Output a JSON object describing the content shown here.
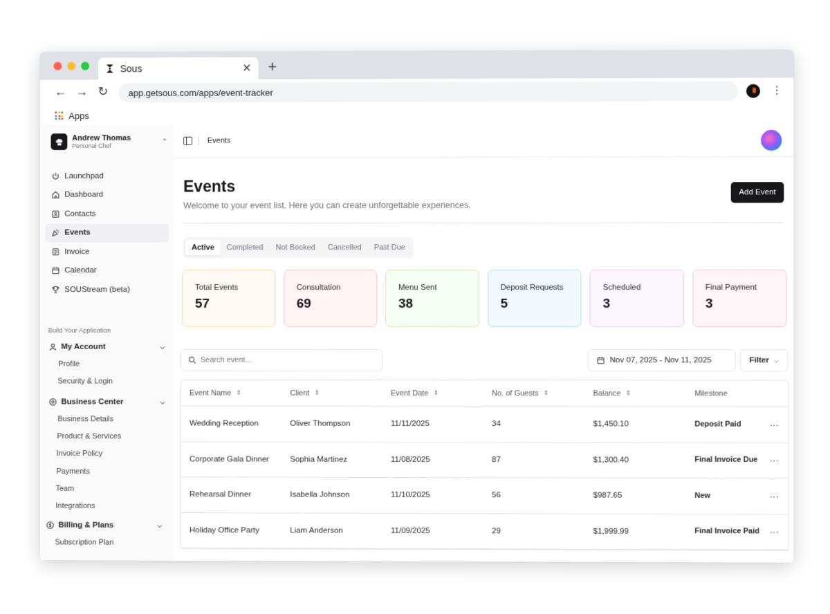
{
  "browser": {
    "tab_title": "Sous",
    "url": "app.getsous.com/apps/event-tracker",
    "bookmarks_label": "Apps"
  },
  "account": {
    "name": "Andrew Thomas",
    "role": "Personal Chef"
  },
  "nav": [
    {
      "label": "Launchpad",
      "icon": "power-icon"
    },
    {
      "label": "Dashboard",
      "icon": "home-icon"
    },
    {
      "label": "Contacts",
      "icon": "contact-card-icon"
    },
    {
      "label": "Events",
      "icon": "party-icon",
      "active": true
    },
    {
      "label": "Invoice",
      "icon": "document-icon"
    },
    {
      "label": "Calendar",
      "icon": "calendar-icon"
    },
    {
      "label": "SOUStream (beta)",
      "icon": "trophy-icon"
    }
  ],
  "section_label": "Build Your Application",
  "groups": {
    "my_account": {
      "label": "My Account",
      "items": [
        "Profile",
        "Security & Login"
      ]
    },
    "business_center": {
      "label": "Business Center",
      "items": [
        "Business Details",
        "Product & Services",
        "Invoice Policy",
        "Payments",
        "Team",
        "Integrations"
      ]
    },
    "billing": {
      "label": "Billing & Plans",
      "items": [
        "Subscription Plan"
      ]
    }
  },
  "header": {
    "breadcrumb": "Events"
  },
  "page": {
    "title": "Events",
    "subtitle": "Welcome to your event list. Here you can create unforgettable experiences.",
    "add_button": "Add Event"
  },
  "tabs": [
    "Active",
    "Completed",
    "Not Booked",
    "Cancelled",
    "Past Due"
  ],
  "stats": [
    {
      "label": "Total Events",
      "value": "57",
      "bg": "#fffaf3",
      "border": "#fcd9a8"
    },
    {
      "label": "Consultation",
      "value": "69",
      "bg": "#fff5f5",
      "border": "#f9c5c5"
    },
    {
      "label": "Menu Sent",
      "value": "38",
      "bg": "#f6fdf2",
      "border": "#c6eeb0"
    },
    {
      "label": "Deposit Requests",
      "value": "5",
      "bg": "#f2f9fe",
      "border": "#b6dcf3"
    },
    {
      "label": "Scheduled",
      "value": "3",
      "bg": "#fbf6fe",
      "border": "#e5cdf5"
    },
    {
      "label": "Final Payment",
      "value": "3",
      "bg": "#fef5f8",
      "border": "#f6c5d6"
    }
  ],
  "search_placeholder": "Search event...",
  "date_range": "Nov 07, 2025 - Nov 11, 2025",
  "filter_label": "Filter",
  "table": {
    "columns": [
      "Event Name",
      "Client",
      "Event Date",
      "No. of Guests",
      "Balance",
      "Milestone"
    ],
    "rows": [
      [
        "Wedding Reception",
        "Oliver Thompson",
        "11/11/2025",
        "34",
        "$1,450.10",
        "Deposit Paid"
      ],
      [
        "Corporate Gala Dinner",
        "Sophia Martinez",
        "11/08/2025",
        "87",
        "$1,300.40",
        "Final Invoice Due"
      ],
      [
        "Rehearsal Dinner",
        "Isabella Johnson",
        "11/10/2025",
        "56",
        "$987.65",
        "New"
      ],
      [
        "Holiday Office Party",
        "Liam Anderson",
        "11/09/2025",
        "29",
        "$1,999.99",
        "Final Invoice Paid"
      ]
    ],
    "row_action": "···"
  }
}
